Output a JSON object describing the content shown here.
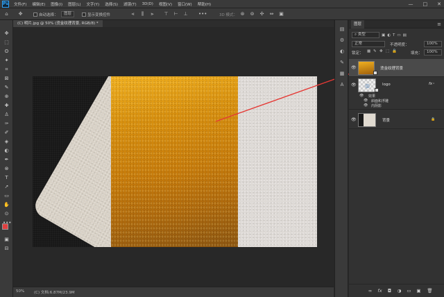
{
  "app": {
    "logo": "Ps"
  },
  "menu": [
    "文件(F)",
    "编辑(E)",
    "图像(I)",
    "图层(L)",
    "文字(Y)",
    "选择(S)",
    "滤镜(T)",
    "3D(D)",
    "视图(V)",
    "窗口(W)",
    "帮助(H)"
  ],
  "window_controls": [
    "—",
    "□",
    "✕"
  ],
  "options_bar": {
    "auto_select_label": "自动选择：",
    "auto_select_target": "图层",
    "show_transform_label": "显示变换控件",
    "mode_3d_label": "3D 模式："
  },
  "document_tab": {
    "label": "(C) 明片.jpg @ 50% (烫金纹理背景, RGB/8) *"
  },
  "toolbox": {
    "tool_glyphs": [
      "✥",
      "⬚",
      "ʘ",
      "✦",
      "⌗",
      "⊠",
      "✎",
      "⊕",
      "✚",
      "♙",
      "✑",
      "✐",
      "◈",
      "◐",
      "✒",
      "⊗",
      "T",
      "➚",
      "▭",
      "✋",
      "⊙",
      "•••",
      "",
      "",
      "▣",
      "⊟"
    ],
    "foreground_color": "#e04040",
    "background_color": "#ffffff"
  },
  "status_bar": {
    "zoom": "50%",
    "doc_info": "(C) 文档:6.87M/23.9M"
  },
  "layers_panel": {
    "tab_title": "图层",
    "filter_label": "类型",
    "blend_mode": "正常",
    "opacity_label": "不透明度：",
    "opacity_value": "100%",
    "lock_label": "锁定：",
    "fill_label": "填充：",
    "fill_value": "100%",
    "layers": [
      {
        "name": "烫金纹理背景",
        "selected": true
      },
      {
        "name": "logo",
        "fx": "fx",
        "effects_label": "效果",
        "effects": [
          "斜面和浮雕",
          "内阴影"
        ]
      },
      {
        "name": "背景",
        "locked": true
      }
    ],
    "footer_icons": [
      "∞",
      "fx",
      "◘",
      "◑",
      "▭",
      "▣",
      "🗑"
    ]
  },
  "colors": {
    "accent": "#31a8ff",
    "arrow": "#e53935",
    "gold_light": "#f0b020",
    "gold_dark": "#8a5410"
  }
}
